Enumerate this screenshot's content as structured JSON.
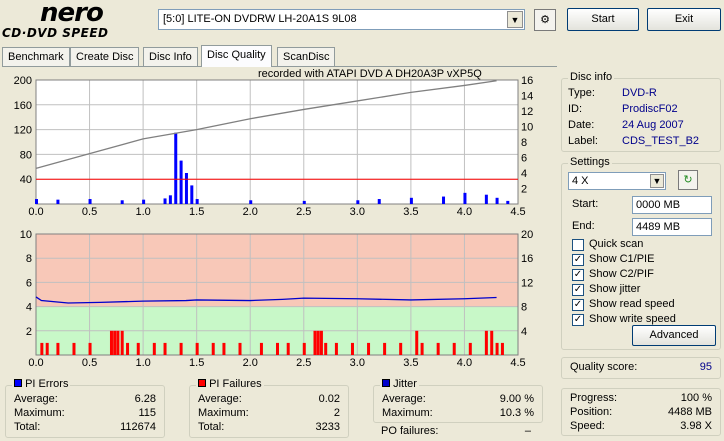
{
  "logo": {
    "title": "nero",
    "subtitle": "CD·DVD SPEED"
  },
  "toolbar": {
    "drive": "[5:0]  LITE-ON DVDRW LH-20A1S 9L08",
    "start": "Start",
    "exit": "Exit"
  },
  "tabs": [
    {
      "label": "Benchmark",
      "active": false
    },
    {
      "label": "Create Disc",
      "active": false
    },
    {
      "label": "Disc Info",
      "active": false
    },
    {
      "label": "Disc Quality",
      "active": true
    },
    {
      "label": "ScanDisc",
      "active": false
    }
  ],
  "recorded_with": "recorded with ATAPI   DVD A  DH20A3P   vXP5Q",
  "chart_data": [
    {
      "type": "bar",
      "name": "PI Errors / read speed",
      "x_ticks": [
        "0.0",
        "0.5",
        "1.0",
        "1.5",
        "2.0",
        "2.5",
        "3.0",
        "3.5",
        "4.0",
        "4.5"
      ],
      "y_left_ticks": [
        "200",
        "160",
        "120",
        "80",
        "40"
      ],
      "y_right_ticks": [
        "16",
        "14",
        "12",
        "10",
        "8",
        "6",
        "4",
        "2"
      ],
      "xlim": [
        0,
        4.5
      ],
      "ylim_left": [
        0,
        200
      ],
      "ylim_right": [
        0,
        16
      ],
      "threshold": 40,
      "series": [
        {
          "values": [
            [
              0,
              8
            ],
            [
              0.2,
              7
            ],
            [
              0.5,
              8
            ],
            [
              0.8,
              6
            ],
            [
              1.0,
              7
            ],
            [
              1.2,
              9
            ],
            [
              1.25,
              14
            ],
            [
              1.3,
              115
            ],
            [
              1.35,
              70
            ],
            [
              1.4,
              50
            ],
            [
              1.45,
              30
            ],
            [
              1.5,
              8
            ],
            [
              2.0,
              6
            ],
            [
              2.5,
              5
            ],
            [
              3.0,
              6
            ],
            [
              3.2,
              8
            ],
            [
              3.5,
              10
            ],
            [
              3.8,
              12
            ],
            [
              4.0,
              18
            ],
            [
              4.2,
              15
            ],
            [
              4.3,
              10
            ],
            [
              4.4,
              5
            ]
          ]
        },
        {
          "values": [
            [
              0.0,
              4.6
            ],
            [
              0.5,
              6.5
            ],
            [
              1.0,
              8.4
            ],
            [
              1.5,
              9.6
            ],
            [
              2.0,
              11.0
            ],
            [
              2.5,
              12.2
            ],
            [
              3.0,
              13.3
            ],
            [
              3.5,
              14.4
            ],
            [
              4.0,
              15.3
            ],
            [
              4.3,
              15.9
            ]
          ]
        }
      ]
    },
    {
      "type": "bar",
      "name": "PI Failures / jitter",
      "x_ticks": [
        "0.0",
        "0.5",
        "1.0",
        "1.5",
        "2.0",
        "2.5",
        "3.0",
        "3.5",
        "4.0",
        "4.5"
      ],
      "y_left_ticks": [
        "10",
        "8",
        "6",
        "4",
        "2"
      ],
      "y_right_ticks": [
        "20",
        "16",
        "12",
        "8",
        "4"
      ],
      "xlim": [
        0,
        4.5
      ],
      "ylim_left": [
        0,
        10
      ],
      "ylim_right": [
        0,
        20
      ],
      "series": [
        {
          "values": [
            [
              0.05,
              1
            ],
            [
              0.1,
              1
            ],
            [
              0.2,
              1
            ],
            [
              0.35,
              1
            ],
            [
              0.5,
              1
            ],
            [
              0.7,
              2
            ],
            [
              0.73,
              2
            ],
            [
              0.76,
              2
            ],
            [
              0.8,
              2
            ],
            [
              0.85,
              1
            ],
            [
              0.95,
              1
            ],
            [
              1.1,
              1
            ],
            [
              1.2,
              1
            ],
            [
              1.35,
              1
            ],
            [
              1.5,
              1
            ],
            [
              1.65,
              1
            ],
            [
              1.75,
              1
            ],
            [
              1.9,
              1
            ],
            [
              2.1,
              1
            ],
            [
              2.25,
              1
            ],
            [
              2.35,
              1
            ],
            [
              2.5,
              1
            ],
            [
              2.6,
              2
            ],
            [
              2.63,
              2
            ],
            [
              2.66,
              2
            ],
            [
              2.7,
              1
            ],
            [
              2.8,
              1
            ],
            [
              2.95,
              1
            ],
            [
              3.1,
              1
            ],
            [
              3.25,
              1
            ],
            [
              3.4,
              1
            ],
            [
              3.55,
              2
            ],
            [
              3.6,
              1
            ],
            [
              3.75,
              1
            ],
            [
              3.9,
              1
            ],
            [
              4.05,
              1
            ],
            [
              4.2,
              2
            ],
            [
              4.25,
              2
            ],
            [
              4.3,
              1
            ],
            [
              4.35,
              1
            ]
          ]
        },
        {
          "values": [
            [
              0.0,
              9.6
            ],
            [
              0.05,
              9.0
            ],
            [
              0.3,
              8.6
            ],
            [
              0.6,
              8.7
            ],
            [
              1.0,
              8.9
            ],
            [
              1.4,
              9.0
            ],
            [
              1.5,
              9.1
            ],
            [
              2.0,
              9.0
            ],
            [
              2.3,
              9.2
            ],
            [
              2.5,
              9.4
            ],
            [
              3.0,
              9.3
            ],
            [
              3.5,
              9.1
            ],
            [
              4.0,
              9.3
            ],
            [
              4.3,
              9.5
            ]
          ]
        }
      ]
    }
  ],
  "disc_info": {
    "title": "Disc info",
    "type_label": "Type:",
    "type": "DVD-R",
    "id_label": "ID:",
    "id": "ProdiscF02",
    "date_label": "Date:",
    "date": "24 Aug 2007",
    "label_label": "Label:",
    "label": "CDS_TEST_B2"
  },
  "settings": {
    "title": "Settings",
    "speed": "4 X",
    "start_label": "Start:",
    "start": "0000 MB",
    "end_label": "End:",
    "end": "4489 MB",
    "checks": [
      {
        "label": "Quick scan",
        "checked": false
      },
      {
        "label": "Show C1/PIE",
        "checked": true
      },
      {
        "label": "Show C2/PIF",
        "checked": true
      },
      {
        "label": "Show jitter",
        "checked": true
      },
      {
        "label": "Show read speed",
        "checked": true
      },
      {
        "label": "Show write speed",
        "checked": true
      }
    ],
    "advanced": "Advanced"
  },
  "quality": {
    "label": "Quality score:",
    "value": "95"
  },
  "progress": {
    "progress_label": "Progress:",
    "progress": "100 %",
    "position_label": "Position:",
    "position": "4488 MB",
    "speed_label": "Speed:",
    "speed": "3.98 X"
  },
  "pi_errors": {
    "title": "PI Errors",
    "avg_label": "Average:",
    "avg": "6.28",
    "max_label": "Maximum:",
    "max": "115",
    "total_label": "Total:",
    "total": "112674"
  },
  "pi_failures": {
    "title": "PI Failures",
    "avg_label": "Average:",
    "avg": "0.02",
    "max_label": "Maximum:",
    "max": "2",
    "total_label": "Total:",
    "total": "3233"
  },
  "jitter": {
    "title": "Jitter",
    "avg_label": "Average:",
    "avg": "9.00 %",
    "max_label": "Maximum:",
    "max": "10.3 %",
    "po_label": "PO failures:",
    "po": "–"
  },
  "colors": {
    "pie": "#0000ff",
    "pif": "#ff0000",
    "speed": "#808080",
    "jitter": "#0000cc",
    "pif_bg_top": "#f8c8b8",
    "pif_bg_bottom": "#c8f8c8",
    "threshold": "#ff0000"
  }
}
